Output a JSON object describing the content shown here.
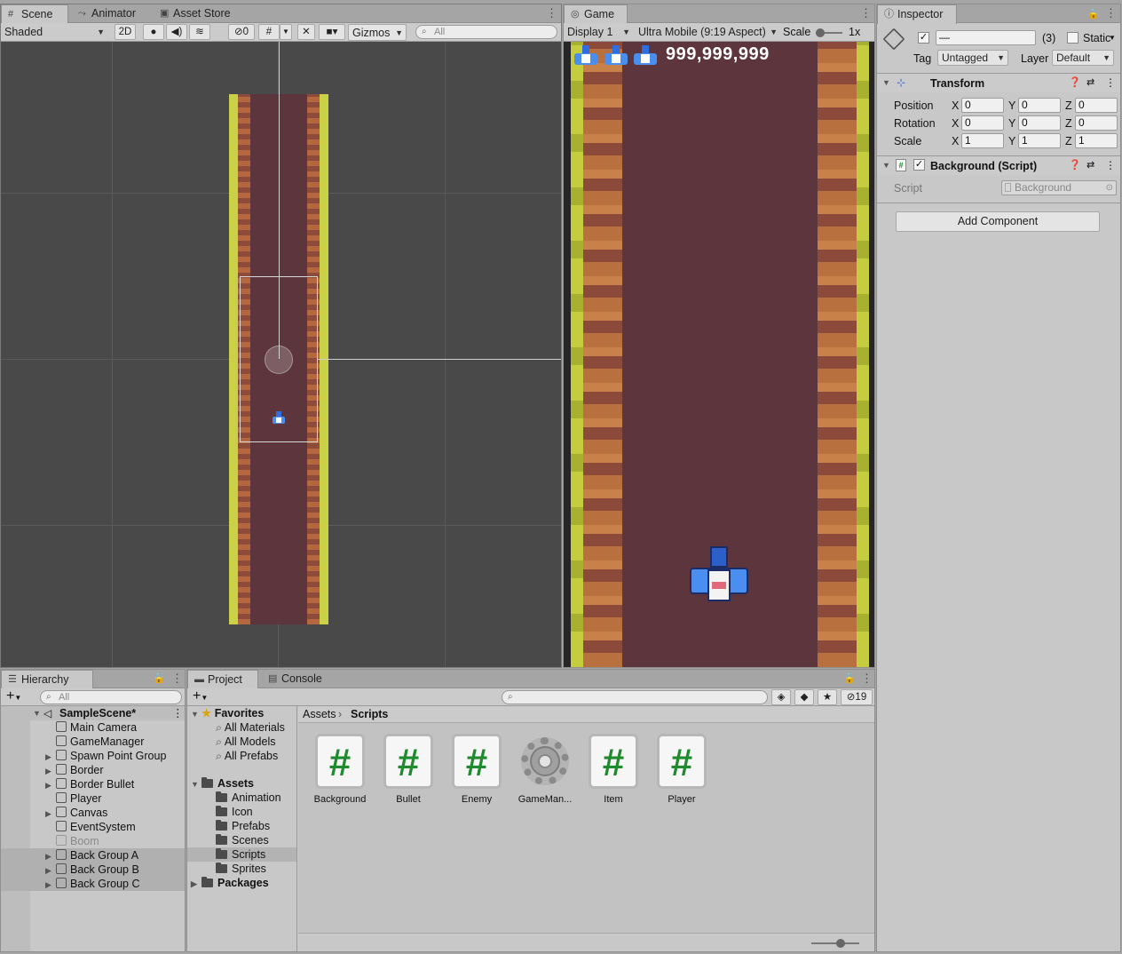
{
  "scene_tabs": {
    "scene": "Scene",
    "animator": "Animator",
    "asset_store": "Asset Store"
  },
  "scene_toolbar": {
    "draw_mode": "Shaded",
    "mode_2d": "2D",
    "hidden_count": "0",
    "gizmos": "Gizmos",
    "search_placeholder": "All"
  },
  "game": {
    "tab": "Game",
    "display": "Display 1",
    "aspect": "Ultra Mobile (9:19 Aspect)",
    "scale_label": "Scale",
    "scale_value": "1x",
    "score": "999,999,999",
    "lives": 3
  },
  "inspector": {
    "tab": "Inspector",
    "object_name": "—",
    "object_count": "(3)",
    "static_label": "Static",
    "tag_label": "Tag",
    "tag_value": "Untagged",
    "layer_label": "Layer",
    "layer_value": "Default",
    "transform": {
      "title": "Transform",
      "position": {
        "label": "Position",
        "x": "0",
        "y": "0",
        "z": "0"
      },
      "rotation": {
        "label": "Rotation",
        "x": "0",
        "y": "0",
        "z": "0"
      },
      "scale": {
        "label": "Scale",
        "x": "1",
        "y": "1",
        "z": "1"
      },
      "axis_x": "X",
      "axis_y": "Y",
      "axis_z": "Z"
    },
    "background_script": {
      "title": "Background (Script)",
      "script_label": "Script",
      "script_value": "Background"
    },
    "add_component": "Add Component"
  },
  "hierarchy": {
    "tab": "Hierarchy",
    "search_placeholder": "All",
    "scene": "SampleScene*",
    "items": [
      {
        "label": "Main Camera"
      },
      {
        "label": "GameManager"
      },
      {
        "label": "Spawn Point Group"
      },
      {
        "label": "Border"
      },
      {
        "label": "Border Bullet"
      },
      {
        "label": "Player"
      },
      {
        "label": "Canvas"
      },
      {
        "label": "EventSystem"
      },
      {
        "label": "Boom"
      },
      {
        "label": "Back Group A"
      },
      {
        "label": "Back Group B"
      },
      {
        "label": "Back Group C"
      }
    ]
  },
  "project": {
    "tab": "Project",
    "console_tab": "Console",
    "hidden_count": "19",
    "favorites": {
      "label": "Favorites",
      "items": [
        "All Materials",
        "All Models",
        "All Prefabs"
      ]
    },
    "assets": {
      "label": "Assets",
      "items": [
        "Animation",
        "Icon",
        "Prefabs",
        "Scenes",
        "Scripts",
        "Sprites"
      ]
    },
    "packages": "Packages",
    "breadcrumb": {
      "root": "Assets",
      "current": "Scripts"
    },
    "files": [
      {
        "label": "Background",
        "icon": "csharp-script-icon"
      },
      {
        "label": "Bullet",
        "icon": "csharp-script-icon"
      },
      {
        "label": "Enemy",
        "icon": "csharp-script-icon"
      },
      {
        "label": "GameMan...",
        "icon": "gear-icon"
      },
      {
        "label": "Item",
        "icon": "csharp-script-icon"
      },
      {
        "label": "Player",
        "icon": "csharp-script-icon"
      }
    ]
  }
}
